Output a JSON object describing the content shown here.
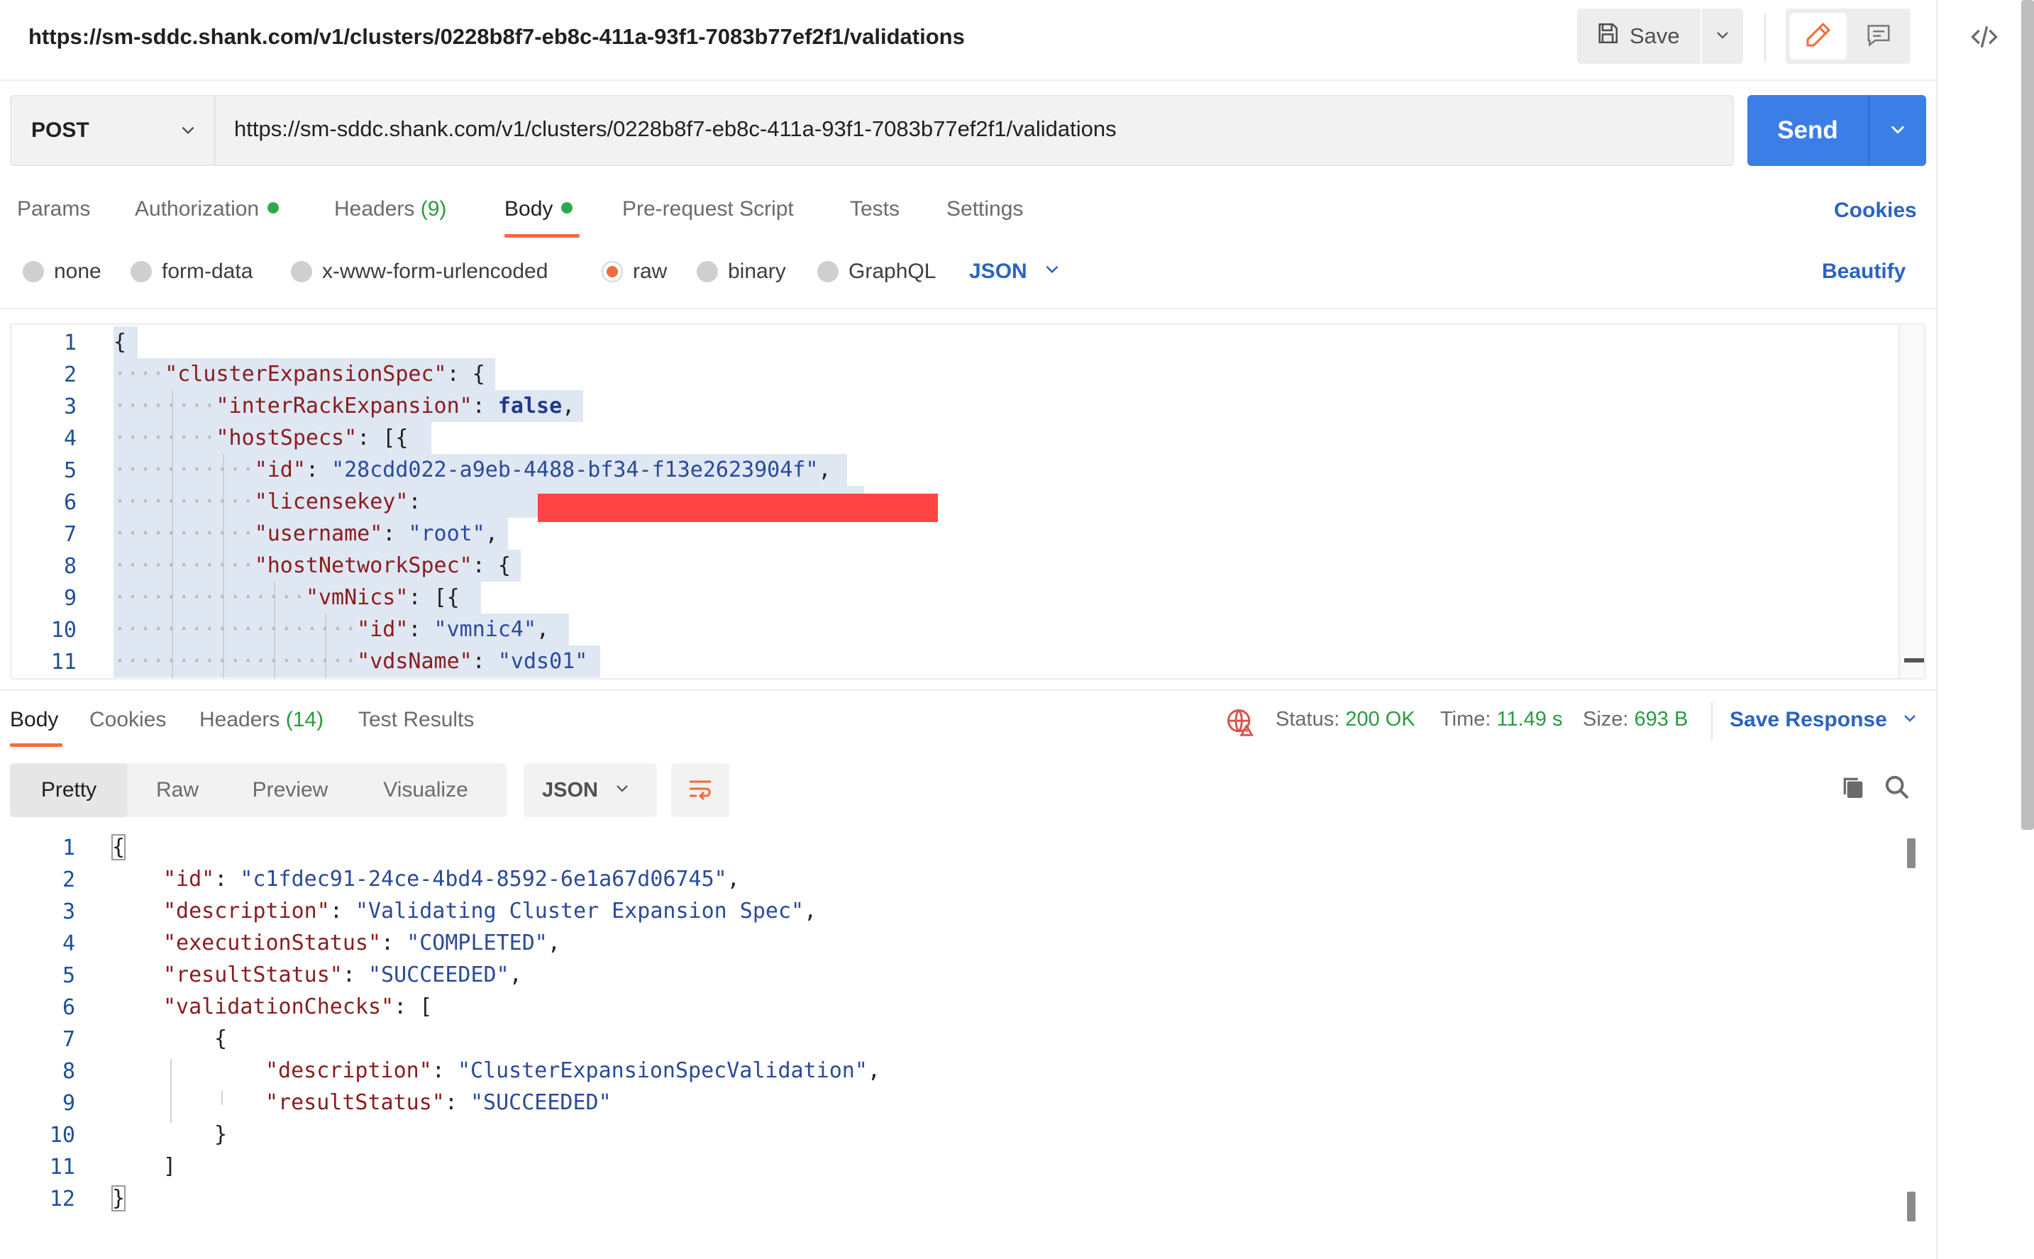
{
  "request": {
    "title": "https://sm-sddc.shank.com/v1/clusters/0228b8f7-eb8c-411a-93f1-7083b77ef2f1/validations",
    "method": "POST",
    "url": "https://sm-sddc.shank.com/v1/clusters/0228b8f7-eb8c-411a-93f1-7083b77ef2f1/validations",
    "save_label": "Save",
    "send_label": "Send"
  },
  "request_tabs": [
    {
      "label": "Params"
    },
    {
      "label": "Authorization"
    },
    {
      "label": "Headers",
      "count": "(9)"
    },
    {
      "label": "Body"
    },
    {
      "label": "Pre-request Script"
    },
    {
      "label": "Tests"
    },
    {
      "label": "Settings"
    }
  ],
  "cookies_label": "Cookies",
  "body_types": [
    "none",
    "form-data",
    "x-www-form-urlencoded",
    "raw",
    "binary",
    "GraphQL"
  ],
  "body_type_selected": "raw",
  "body_language": "JSON",
  "beautify_label": "Beautify",
  "request_body_lines": [
    {
      "n": "1",
      "text": "{"
    },
    {
      "n": "2",
      "key": "\"clusterExpansionSpec\"",
      "rest": ": {"
    },
    {
      "n": "3",
      "key": "\"interRackExpansion\"",
      "rest_bool": "false",
      "tail": ","
    },
    {
      "n": "4",
      "key": "\"hostSpecs\"",
      "rest": ": [{"
    },
    {
      "n": "5",
      "key": "\"id\"",
      "value": "\"28cdd022-a9eb-4488-bf34-f13e2623904f\"",
      "tail": ","
    },
    {
      "n": "6",
      "key": "\"licensekey\"",
      "rest": ": "
    },
    {
      "n": "7",
      "key": "\"username\"",
      "value": "\"root\"",
      "tail": ","
    },
    {
      "n": "8",
      "key": "\"hostNetworkSpec\"",
      "rest": ": {"
    },
    {
      "n": "9",
      "key": "\"vmNics\"",
      "rest": ": [{"
    },
    {
      "n": "10",
      "key": "\"id\"",
      "value": "\"vmnic4\"",
      "tail": ","
    },
    {
      "n": "11",
      "key": "\"vdsName\"",
      "value": "\"vds01\"",
      "tail": ""
    }
  ],
  "response_tabs": [
    {
      "label": "Body"
    },
    {
      "label": "Cookies"
    },
    {
      "label": "Headers",
      "count": "(14)"
    },
    {
      "label": "Test Results"
    }
  ],
  "response_meta": {
    "status_label": "Status:",
    "status_value": "200 OK",
    "time_label": "Time:",
    "time_value": "11.49 s",
    "size_label": "Size:",
    "size_value": "693 B",
    "save_response_label": "Save Response"
  },
  "response_views": [
    "Pretty",
    "Raw",
    "Preview",
    "Visualize"
  ],
  "response_view_selected": "Pretty",
  "response_language": "JSON",
  "response_body_lines": [
    {
      "n": "1",
      "text": "{"
    },
    {
      "n": "2",
      "key": "\"id\"",
      "value": "\"c1fdec91-24ce-4bd4-8592-6e1a67d06745\"",
      "tail": ","
    },
    {
      "n": "3",
      "key": "\"description\"",
      "value": "\"Validating Cluster Expansion Spec\"",
      "tail": ","
    },
    {
      "n": "4",
      "key": "\"executionStatus\"",
      "value": "\"COMPLETED\"",
      "tail": ","
    },
    {
      "n": "5",
      "key": "\"resultStatus\"",
      "value": "\"SUCCEEDED\"",
      "tail": ","
    },
    {
      "n": "6",
      "key": "\"validationChecks\"",
      "rest": ": ["
    },
    {
      "n": "7",
      "text": "{"
    },
    {
      "n": "8",
      "key": "\"description\"",
      "value": "\"ClusterExpansionSpecValidation\"",
      "tail": ","
    },
    {
      "n": "9",
      "key": "\"resultStatus\"",
      "value": "\"SUCCEEDED\"",
      "tail": ""
    },
    {
      "n": "10",
      "text": "}"
    },
    {
      "n": "11",
      "text": "]"
    },
    {
      "n": "12",
      "text": "}"
    }
  ],
  "colors": {
    "accent_orange": "#f26b3a",
    "send_blue": "#3b7ee6",
    "link_blue": "#2b63c4",
    "success_green": "#2a9a3f",
    "json_key": "#8a1c1c",
    "json_string": "#2a4a9a",
    "redaction": "#ff4444"
  },
  "icons": {
    "save": "floppy-disk-icon",
    "edit": "pencil-icon",
    "comment": "comment-icon",
    "code": "code-snippet-icon",
    "globe": "globe-warning-icon",
    "wrap": "wrap-lines-icon",
    "copy": "copy-icon",
    "search": "search-icon"
  }
}
